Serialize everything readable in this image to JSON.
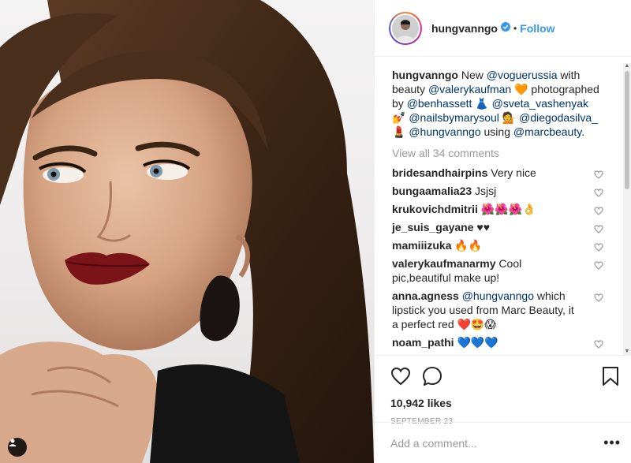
{
  "post": {
    "username": "hungvanngo",
    "follow_label": "Follow",
    "dot": "•"
  },
  "caption": {
    "username": "hungvanngo",
    "parts": [
      {
        "t": " New ",
        "m": false
      },
      {
        "t": "@voguerussia",
        "m": true
      },
      {
        "t": " with beauty ",
        "m": false
      },
      {
        "t": "@valerykaufman",
        "m": true
      },
      {
        "t": " 🧡 photographed by ",
        "m": false
      },
      {
        "t": "@benhassett",
        "m": true
      },
      {
        "t": " 👗 ",
        "m": false
      },
      {
        "t": "@sveta_vashenyak",
        "m": true
      },
      {
        "t": " 💅 ",
        "m": false
      },
      {
        "t": "@nailsbymarysoul",
        "m": true
      },
      {
        "t": " 💁 ",
        "m": false
      },
      {
        "t": "@diegodasilva_",
        "m": true
      },
      {
        "t": " 💄 ",
        "m": false
      },
      {
        "t": "@hungvanngo",
        "m": true
      },
      {
        "t": " using ",
        "m": false
      },
      {
        "t": "@marcbeauty",
        "m": true
      },
      {
        "t": ".",
        "m": false
      }
    ]
  },
  "view_all_label": "View all 34 comments",
  "comments": [
    {
      "user": "bridesandhairpins",
      "parts": [
        {
          "t": " Very nice",
          "m": false
        }
      ]
    },
    {
      "user": "bungaamalia23",
      "parts": [
        {
          "t": " Jsjsj",
          "m": false
        }
      ]
    },
    {
      "user": "krukovichdmitrii",
      "parts": [
        {
          "t": " 🌺🌺🌺👌",
          "m": false
        }
      ]
    },
    {
      "user": "je_suis_gayane",
      "parts": [
        {
          "t": " ♥♥",
          "m": false
        }
      ]
    },
    {
      "user": "mamiiizuka",
      "parts": [
        {
          "t": " 🔥🔥",
          "m": false
        }
      ]
    },
    {
      "user": "valerykaufmanarmy",
      "parts": [
        {
          "t": " Cool pic,beautiful make up!",
          "m": false
        }
      ]
    },
    {
      "user": "anna.agness",
      "parts": [
        {
          "t": " ",
          "m": false
        },
        {
          "t": "@hungvanngo",
          "m": true
        },
        {
          "t": " which lipstick you used from Marc Beauty, it a perfect red ❤️🤩😱",
          "m": false
        }
      ]
    },
    {
      "user": "noam_pathi",
      "parts": [
        {
          "t": " 💙💙💙",
          "m": false
        }
      ]
    }
  ],
  "likes_label": "10,942 likes",
  "date_label": "SEPTEMBER 23",
  "add_comment_placeholder": "Add a comment...",
  "more_label": "•••",
  "colors": {
    "link": "#3897f0",
    "mention": "#003569",
    "muted": "#999999",
    "verified": "#3897f0"
  }
}
